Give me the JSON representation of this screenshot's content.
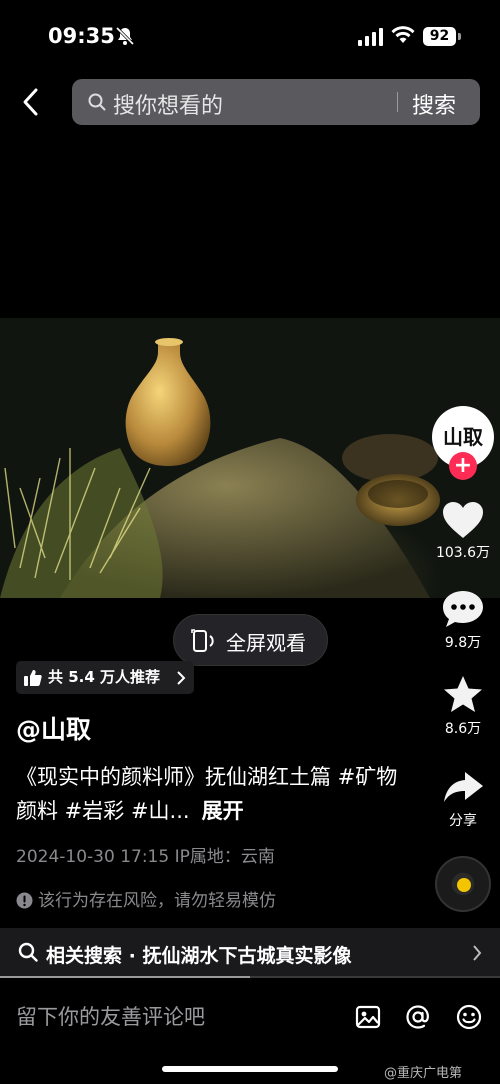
{
  "status_bar": {
    "time": "09:35",
    "battery": "92"
  },
  "search": {
    "placeholder": "搜你想看的",
    "button_label": "搜索"
  },
  "video": {
    "fullscreen_label": "全屏观看"
  },
  "rail": {
    "avatar_text": "山取",
    "follow_symbol": "+",
    "likes": "103.6万",
    "comments": "9.8万",
    "favorites": "8.6万",
    "share": "分享"
  },
  "info": {
    "recommend": "共 5.4 万人推荐",
    "author": "@山取",
    "caption": "《现实中的颜料师》抚仙湖红土篇 #矿物颜料 #岩彩 #山...",
    "expand": "展开",
    "meta": "2024-10-30 17:15  IP属地：云南",
    "warning": "该行为存在风险，请勿轻易模仿"
  },
  "related": {
    "label": "相关搜索 · 抚仙湖水下古城真实影像",
    "progress": 0.5
  },
  "comment": {
    "placeholder": "留下你的友善评论吧"
  },
  "watermark": "@重庆广电第"
}
